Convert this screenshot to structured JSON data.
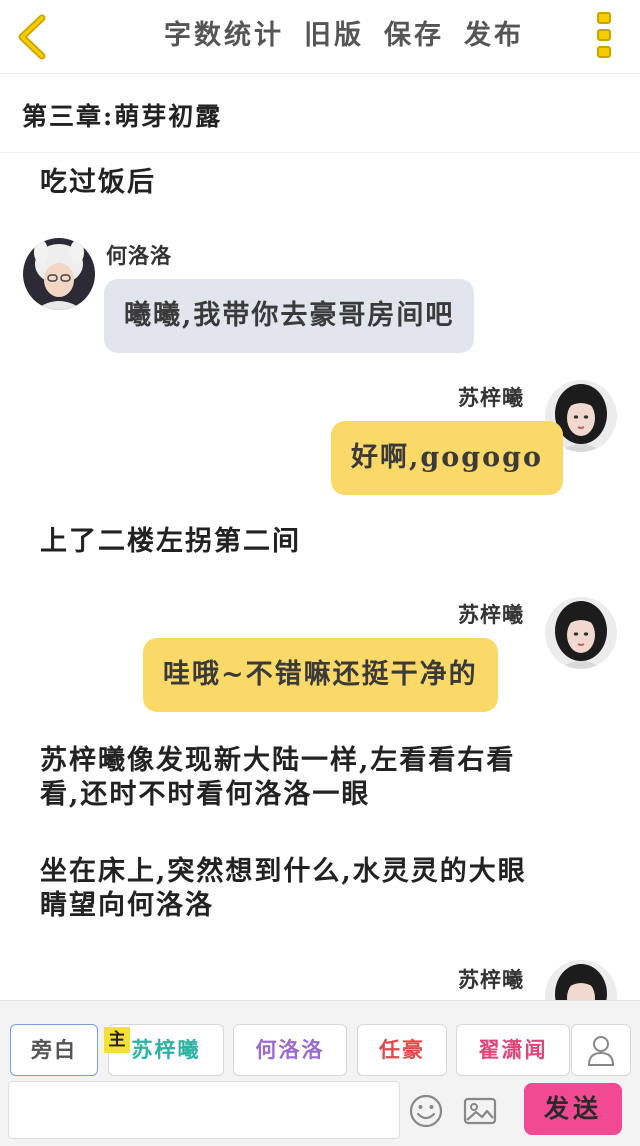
{
  "topbar": {
    "actions": [
      "字数统计",
      "旧版",
      "保存",
      "发布"
    ]
  },
  "chapter": {
    "title": "第三章:萌芽初露"
  },
  "story": {
    "narration_1": "吃过饭后",
    "msg_1": {
      "speaker": "何洛洛",
      "text": "曦曦,我带你去豪哥房间吧"
    },
    "msg_2": {
      "speaker": "苏梓曦",
      "text": "好啊,gogogo"
    },
    "narration_2": "上了二楼左拐第二间",
    "msg_3": {
      "speaker": "苏梓曦",
      "text": "哇哦~不错嘛还挺干净的"
    },
    "narration_3_line1": "苏梓曦像发现新大陆一样,左看看右看",
    "narration_3_line2": "看,还时不时看何洛洛一眼",
    "narration_4_line1": "坐在床上,突然想到什么,水灵灵的大眼",
    "narration_4_line2": "睛望向何洛洛",
    "msg_4": {
      "speaker": "苏梓曦"
    }
  },
  "composer": {
    "roles": [
      {
        "label": "旁白",
        "color": "#555555"
      },
      {
        "label": "苏梓曦",
        "color": "#2bb3a3"
      },
      {
        "label": "何洛洛",
        "color": "#9b6bd0"
      },
      {
        "label": "任豪",
        "color": "#e34848"
      },
      {
        "label": "翟潇闻",
        "color": "#e0447a"
      }
    ],
    "main_tag": "主",
    "input_placeholder": "",
    "send_label": "发送"
  },
  "colors": {
    "left_bubble": "#e1e6ee",
    "right_bubble": "#fbd968",
    "send_button": "#f14a93",
    "menu_accent": "#f4cc00"
  }
}
